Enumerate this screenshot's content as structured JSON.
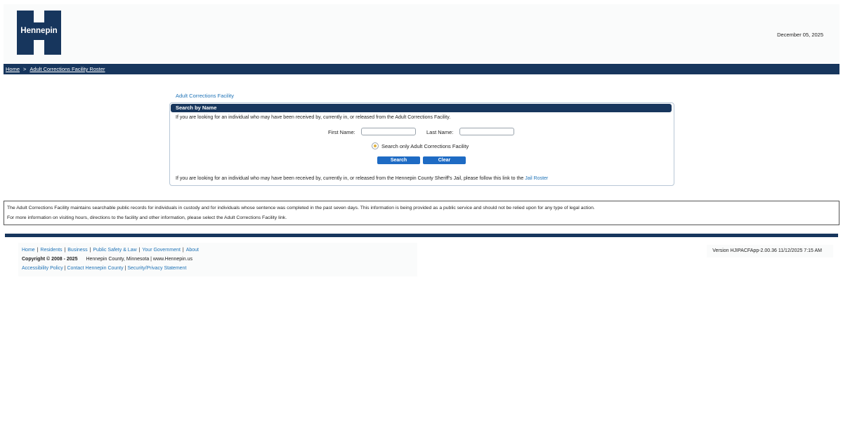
{
  "header": {
    "logo_text": "Hennepin",
    "date": "December 05, 2025"
  },
  "breadcrumb": {
    "home": "Home",
    "separator": ">",
    "current": "Adult Corrections Facility Roster"
  },
  "section_title": "Adult Corrections Facility",
  "search_panel": {
    "title": "Search by Name",
    "intro": "If you are looking for an individual who may have been received by, currently in, or released from the Adult Corrections Facility.",
    "first_name_label": "First Name:",
    "first_name_value": "",
    "last_name_label": "Last Name:",
    "last_name_value": "",
    "radio_label": "Search only Adult Corrections Facility",
    "radio_selected": true,
    "search_button": "Search",
    "clear_button": "Clear",
    "jail_text": "If you are looking for an individual who may have been received by, currently in, or released from the Hennepin County Sheriff's Jail, please follow this link to the",
    "jail_link": "Jail Roster"
  },
  "info": {
    "line1": "The Adult Corrections Facility maintains searchable public records for individuals in custody and for individuals whose sentence was completed in the past seven days. This information is being provided as a public service and should not be relied upon for any type of legal action.",
    "line2": "For more information on visiting hours, directions to the facility and other information, please select the Adult Corrections Facility link."
  },
  "footer": {
    "links": [
      "Home",
      "Residents",
      "Business",
      "Public Safety & Law",
      "Your Government",
      "About"
    ],
    "copyright": "Copyright © 2008 - 2025",
    "county_text": "Hennepin County, Minnesota | www.Hennepin.us",
    "links2": [
      "Accessibility Policy",
      "Contact Hennepin County",
      "Security/Privacy Statement"
    ],
    "version": "Version HJIPACFApp-2.00.36 11/12/2025 7:15 AM"
  },
  "colors": {
    "navy": "#17365d",
    "link_blue": "#1f73b7",
    "button_blue": "#1e6bc4",
    "radio_gold": "#e0b13c"
  }
}
